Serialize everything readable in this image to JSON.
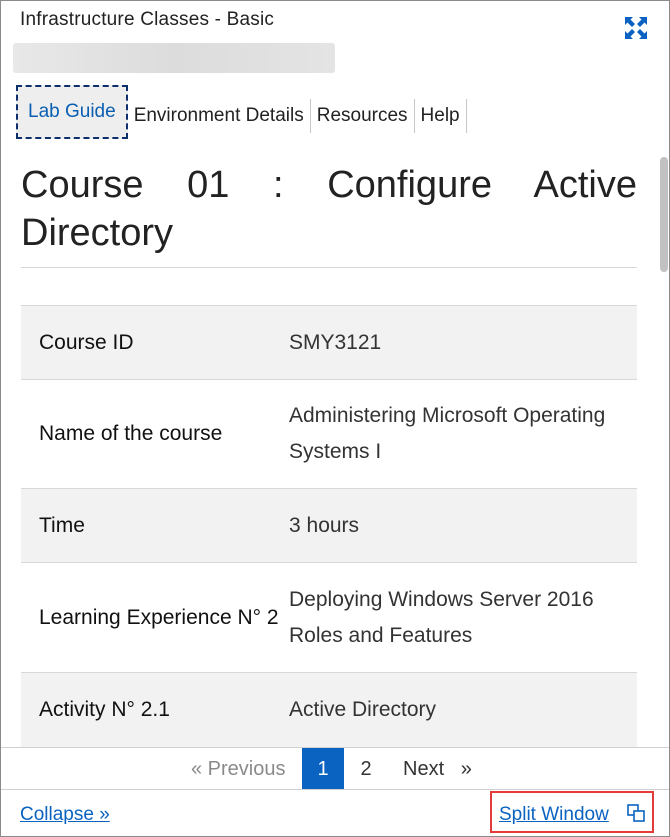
{
  "window": {
    "title": "Infrastructure Classes - Basic"
  },
  "tabs": [
    {
      "label": "Lab Guide",
      "active": true
    },
    {
      "label": "Environment Details",
      "active": false
    },
    {
      "label": "Resources",
      "active": false
    },
    {
      "label": "Help",
      "active": false
    }
  ],
  "content": {
    "heading": "Course 01 : Configure Active Directory",
    "table": [
      {
        "key": "Course ID",
        "value": "SMY3121"
      },
      {
        "key": "Name of the course",
        "value": "Administering Microsoft Operating Systems I"
      },
      {
        "key": "Time",
        "value": "3 hours"
      },
      {
        "key": "Learning Experience N° 2",
        "value": "Deploying Windows Server 2016 Roles and Features"
      },
      {
        "key": "Activity N° 2.1",
        "value": "Active Directory"
      }
    ]
  },
  "pager": {
    "prev": "« Previous",
    "page1": "1",
    "page2": "2",
    "next": "Next   »"
  },
  "footer": {
    "collapse": "Collapse »",
    "split": "Split Window"
  },
  "icons": {
    "expand": "expand-icon",
    "split": "split-window-icon"
  },
  "colors": {
    "accent": "#0b63c1",
    "highlight_border": "#e53b3b"
  }
}
